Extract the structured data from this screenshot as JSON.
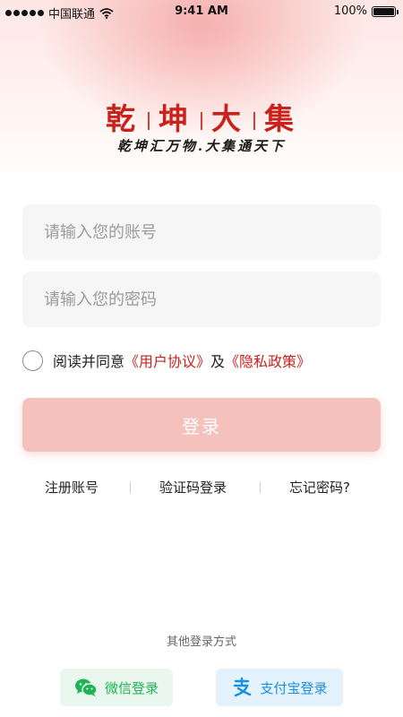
{
  "status_bar": {
    "carrier": "中国联通",
    "time": "9:41 AM",
    "battery": "100%"
  },
  "logo": {
    "title_chars": [
      "乾",
      "坤",
      "大",
      "集"
    ],
    "slogan": "乾坤汇万物.大集通天下"
  },
  "form": {
    "account_placeholder": "请输入您的账号",
    "account_value": "",
    "password_placeholder": "请输入您的密码",
    "password_value": "",
    "agreement_prefix": "阅读并同意",
    "user_agreement": "《用户协议》",
    "agreement_and": "及",
    "privacy_policy": "《隐私政策》",
    "login_label": "登录"
  },
  "links": {
    "register": "注册账号",
    "sms_login": "验证码登录",
    "forgot_password": "忘记密码?"
  },
  "other_login": {
    "title": "其他登录方式",
    "wechat_label": "微信登录",
    "alipay_label": "支付宝登录"
  },
  "colors": {
    "brand_red": "#c9221c",
    "login_button": "#f5c1bd",
    "wechat_green": "#20b254",
    "alipay_blue": "#1a8fe0"
  },
  "icons": [
    "wifi-icon",
    "battery-icon",
    "wechat-icon",
    "alipay-icon",
    "radio-unchecked-icon"
  ]
}
